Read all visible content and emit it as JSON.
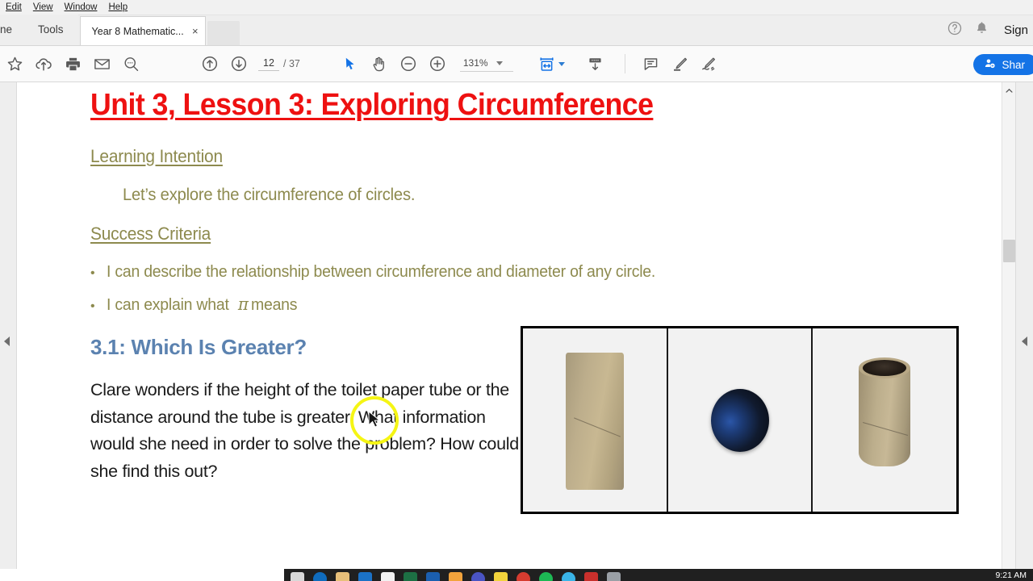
{
  "menubar": {
    "items": [
      {
        "label": "Edit",
        "icon": "menu-edit"
      },
      {
        "label": "View",
        "icon": "menu-view"
      },
      {
        "label": "Window",
        "icon": "menu-window"
      },
      {
        "label": "Help",
        "icon": "menu-help"
      }
    ]
  },
  "tabstrip": {
    "home_label": "ne",
    "tools_label": "Tools",
    "document_tab": {
      "label": "Year 8 Mathematic...",
      "close_glyph": "×"
    },
    "help_icon": "help-circle-icon",
    "bell_icon": "bell-icon",
    "signin_label": "Sign"
  },
  "toolbar": {
    "buttons": [
      {
        "name": "star-icon",
        "title": "Add to favourites"
      },
      {
        "name": "cloud-upload-icon",
        "title": "Save to cloud"
      },
      {
        "name": "print-icon",
        "title": "Print file"
      },
      {
        "name": "email-icon",
        "title": "Send by email"
      },
      {
        "name": "search-icon",
        "title": "Find text"
      },
      {
        "name": "page-up-icon",
        "title": "Previous page"
      },
      {
        "name": "page-down-icon",
        "title": "Next page"
      },
      {
        "name": "select-cursor-icon",
        "title": "Select tool"
      },
      {
        "name": "hand-pan-icon",
        "title": "Hand tool"
      },
      {
        "name": "zoom-out-icon",
        "title": "Zoom out"
      },
      {
        "name": "zoom-in-icon",
        "title": "Zoom in"
      },
      {
        "name": "fit-page-icon",
        "title": "Fit page"
      },
      {
        "name": "scroll-mode-icon",
        "title": "Page display"
      },
      {
        "name": "comment-icon",
        "title": "Add comment"
      },
      {
        "name": "highlight-pen-icon",
        "title": "Highlight text"
      },
      {
        "name": "sign-icon",
        "title": "Fill and sign"
      }
    ],
    "page_current": "12",
    "page_total": "/ 37",
    "zoom_value": "131%",
    "share_label": "Shar",
    "share_icon": "add-person-icon",
    "share_color": "#1473e6"
  },
  "document": {
    "title": "Unit 3, Lesson 3: Exploring Circumference",
    "title_color": "#ee1111",
    "learning_intention_heading": "Learning Intention",
    "learning_intention_text": "Let’s explore the circumference of circles.",
    "success_criteria_heading": "Success Criteria",
    "accent_color": "#8d8a4e",
    "criteria": [
      {
        "bullet": "•",
        "text_before": "I can describe the relationship between circumference and diameter of any circle.",
        "symbol": "",
        "text_after": ""
      },
      {
        "bullet": "•",
        "text_before": "I can explain what",
        "symbol": "π",
        "text_after": "means"
      }
    ],
    "activity_heading": "3.1: Which Is Greater?",
    "activity_heading_color": "#5b82b0",
    "activity_body": "Clare wonders if the height of the toilet paper tube or the distance around the tube is greater. What information would she need in order to solve the problem? How could she find this out?",
    "figure": {
      "name": "toilet-paper-tube-photo-strip",
      "panels": [
        {
          "caption": "",
          "view": "side-view-cardboard-tube"
        },
        {
          "caption": "",
          "view": "top-down-view-tube-opening"
        },
        {
          "caption": "",
          "view": "angled-3d-view-cardboard-tube"
        }
      ]
    }
  },
  "viewer": {
    "left_rail_collapse_icon": "collapse-left-arrow-icon",
    "right_rail_collapse_icon": "collapse-right-arrow-icon",
    "scroll_up_glyph": "˄",
    "cursor_highlight_color": "#f5f514"
  },
  "taskbar": {
    "clock": "9:21 AM",
    "icons": [
      {
        "name": "task-view-icon",
        "color": "#d8d8d8"
      },
      {
        "name": "edge-browser-icon",
        "color": "#0f6cbd"
      },
      {
        "name": "file-explorer-icon",
        "color": "#e8c07a"
      },
      {
        "name": "outlook-icon",
        "color": "#1b72c6"
      },
      {
        "name": "store-icon",
        "color": "#f2f2f2"
      },
      {
        "name": "excel-icon",
        "color": "#1d7044"
      },
      {
        "name": "word-icon",
        "color": "#1b5fb0"
      },
      {
        "name": "photos-icon",
        "color": "#f2a33c"
      },
      {
        "name": "teams-icon",
        "color": "#4a54c4"
      },
      {
        "name": "notes-icon",
        "color": "#f2d33c"
      },
      {
        "name": "recording-icon",
        "color": "#d63c30"
      },
      {
        "name": "spotify-icon",
        "color": "#1db954"
      },
      {
        "name": "chrome-icon",
        "color": "#3ab5e8"
      },
      {
        "name": "acrobat-icon",
        "color": "#c9302c"
      },
      {
        "name": "settings-icon",
        "color": "#9aa0a6"
      }
    ]
  }
}
